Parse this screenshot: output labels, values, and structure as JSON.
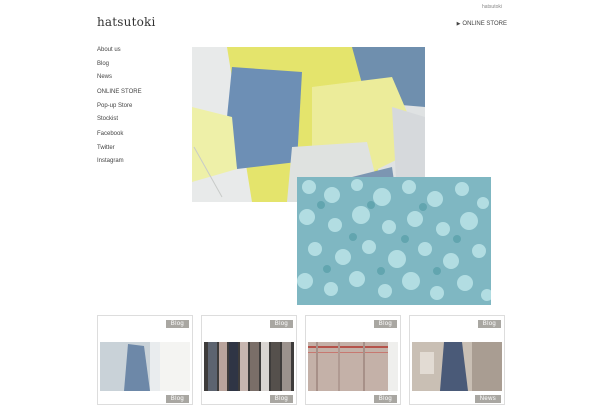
{
  "header": {
    "top_text": "hatsutoki",
    "logo": "hatsutoki",
    "online_store": "ONLINE STORE",
    "online_store_arrow": "▶"
  },
  "sidebar": {
    "items": [
      {
        "label": "About us"
      },
      {
        "label": "Blog"
      },
      {
        "label": "News"
      },
      {
        "label": "ONLINE STORE"
      },
      {
        "label": "Pop-up Store"
      },
      {
        "label": "Stockist"
      },
      {
        "label": "Facebook"
      },
      {
        "label": "Twitter"
      },
      {
        "label": "Instagram"
      }
    ]
  },
  "cards": [
    {
      "badge": "Blog",
      "badge2": "Blog"
    },
    {
      "badge": "Blog",
      "badge2": "Blog"
    },
    {
      "badge": "Blog",
      "badge2": "Blog"
    },
    {
      "badge": "Blog",
      "badge2": "News"
    }
  ],
  "colors": {
    "badge_bg": "#a9a7a2",
    "text": "#444444"
  }
}
